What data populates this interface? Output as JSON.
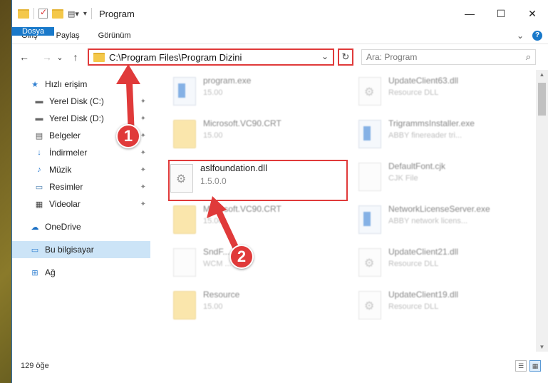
{
  "window": {
    "title": "Program"
  },
  "ribbon": {
    "tabs": [
      "Dosya",
      "Giriş",
      "Paylaş",
      "Görünüm"
    ],
    "more": "⌄",
    "help": "?"
  },
  "window_controls": {
    "minimize": "—",
    "maximize": "☐",
    "close": "✕"
  },
  "navigation": {
    "back": "←",
    "forward": "→",
    "recent": "⌄",
    "up": "↑"
  },
  "address": {
    "path": "C:\\Program Files\\Program Dizini",
    "dropdown": "⌄",
    "refresh": "↻"
  },
  "search": {
    "placeholder": "Ara: Program",
    "icon": "search-icon"
  },
  "sidebar": {
    "items": [
      {
        "label": "Hızlı erişim",
        "icon": "star-icon",
        "pinned": false
      },
      {
        "label": "Yerel Disk (C:)",
        "icon": "drive-icon",
        "pinned": true
      },
      {
        "label": "Yerel Disk (D:)",
        "icon": "drive-icon",
        "pinned": true
      },
      {
        "label": "Belgeler",
        "icon": "documents-icon",
        "pinned": true
      },
      {
        "label": "İndirmeler",
        "icon": "download-icon",
        "pinned": true
      },
      {
        "label": "Müzik",
        "icon": "music-icon",
        "pinned": true
      },
      {
        "label": "Resimler",
        "icon": "pictures-icon",
        "pinned": true
      },
      {
        "label": "Videolar",
        "icon": "video-icon",
        "pinned": true
      },
      {
        "label": "OneDrive",
        "icon": "cloud-icon",
        "pinned": false
      },
      {
        "label": "Bu bilgisayar",
        "icon": "computer-icon",
        "pinned": false,
        "selected": true
      },
      {
        "label": "Ağ",
        "icon": "network-icon",
        "pinned": false
      }
    ],
    "pin_glyph": "📌"
  },
  "files": [
    {
      "name": "program.exe",
      "sub": "15.00",
      "icon": "app"
    },
    {
      "name": "UpdateClient63.dll",
      "sub": "Resource DLL",
      "icon": "gear"
    },
    {
      "name": "Microsoft.VC90.CRT",
      "sub": "15.00",
      "icon": "folder"
    },
    {
      "name": "TrigrammsInstaller.exe",
      "sub": "ABBY finereader tri...",
      "icon": "app"
    },
    {
      "name": "aslfoundation.dll",
      "sub": "1.5.0.0",
      "icon": "gear"
    },
    {
      "name": "DefaultFont.cjk",
      "sub": "CJK File",
      "icon": "blank"
    },
    {
      "name": "Microsoft.VC90.CRT",
      "sub": "15.00",
      "icon": "folder"
    },
    {
      "name": "NetworkLicenseServer.exe",
      "sub": "ABBY network licens...",
      "icon": "app"
    },
    {
      "name": "SndF....wcm",
      "sub": "WCM ...",
      "icon": "blank"
    },
    {
      "name": "UpdateClient21.dll",
      "sub": "Resource DLL",
      "icon": "gear"
    },
    {
      "name": "Resource",
      "sub": "15.00",
      "icon": "folder"
    },
    {
      "name": "UpdateClient19.dll",
      "sub": "Resource DLL",
      "icon": "gear"
    }
  ],
  "status": {
    "count": "129 öğe"
  },
  "annotations": {
    "step1": "1",
    "step2": "2",
    "color": "#e03a3a"
  }
}
